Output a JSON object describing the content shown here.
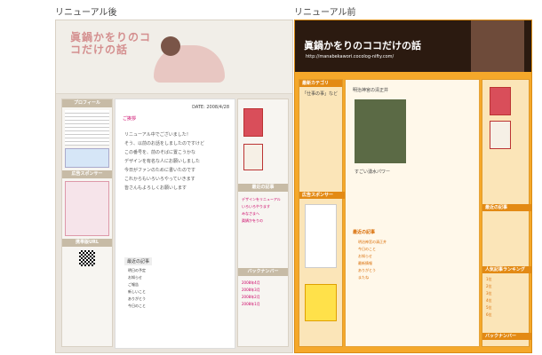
{
  "labels": {
    "after": "リニューアル後",
    "before": "リニューアル前"
  },
  "after": {
    "title": "眞鍋かをりのココだけの話",
    "sidebar_heads": [
      "プロフィール",
      "広告スポンサー",
      "携帯版URL"
    ],
    "date": "DATE: 2008/4/28",
    "tag": "ご挨拶",
    "lines": [
      "リニューアル中でございました！",
      "そう、以前のお話をしましたのですけど",
      "この番号を、前のそばに置こうかな",
      "デザインを有名な人にお願いしました",
      "今日がファンのために書いたのです",
      "これからもいろいろやっていきます",
      "皆さんもよろしくお願いします"
    ],
    "recent_head": "最近の記事",
    "recent_list": [
      "明日の予定",
      "お知らせ",
      "ご報告",
      "新しいこと",
      "ありがとう",
      "今日のこと"
    ],
    "right_heads": [
      "最近の記事",
      "バックナンバー"
    ],
    "right_links": [
      "デザインをリニューアル",
      "いろいろやります",
      "みなさまへ",
      "眞鍋かをりの"
    ],
    "backnumber": [
      "2008年4月",
      "2008年3月",
      "2008年2月",
      "2008年1月"
    ]
  },
  "before": {
    "title": "眞鍋かをりのココだけの話",
    "url": "http://manabekawori.cocolog-nifty.com/",
    "side_head": "最新カテゴリ",
    "side_text": "「仕事の事」など",
    "post_title": "明治神宮の清正井",
    "post_caption": "すごい湧水パワー",
    "sponsor_head": "広告スポンサー",
    "recent_head": "最近の記事",
    "recent_list": [
      "明治神宮の清正井",
      "今日のこと",
      "お知らせ",
      "最新情報",
      "ありがとう",
      "またね"
    ],
    "right_head": "最近の記事",
    "rank_head": "人気記事ランキング",
    "rank_list": [
      "1位",
      "2位",
      "3位",
      "4位",
      "5位",
      "6位"
    ],
    "backnumber_head": "バックナンバー"
  }
}
